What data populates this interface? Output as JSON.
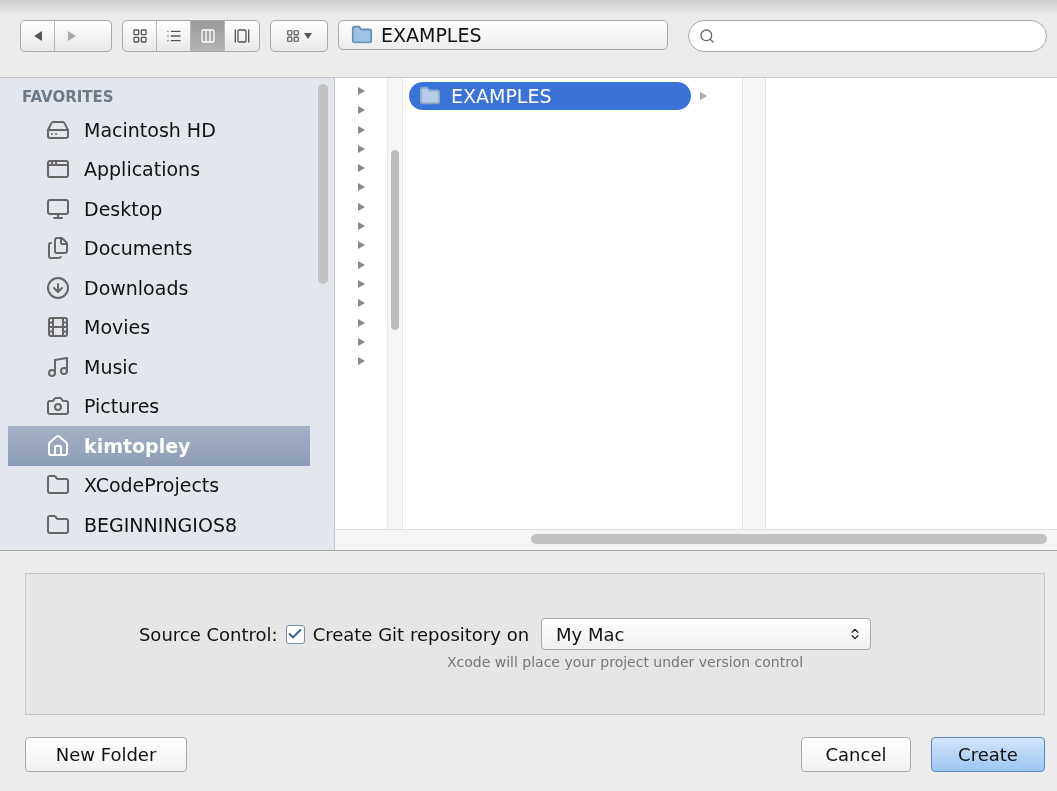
{
  "toolbar": {
    "view_modes": [
      {
        "kind": "icons",
        "selected": false
      },
      {
        "kind": "list",
        "selected": false
      },
      {
        "kind": "columns",
        "selected": true
      },
      {
        "kind": "coverflow",
        "selected": false
      }
    ],
    "path": "EXAMPLES"
  },
  "sidebar": {
    "heading": "FAVORITES",
    "items": [
      {
        "label": "Macintosh HD",
        "selected": false
      },
      {
        "label": "Applications",
        "selected": false
      },
      {
        "label": "Desktop",
        "selected": false
      },
      {
        "label": "Documents",
        "selected": false
      },
      {
        "label": "Downloads",
        "selected": false
      },
      {
        "label": "Movies",
        "selected": false
      },
      {
        "label": "Music",
        "selected": false
      },
      {
        "label": "Pictures",
        "selected": false
      },
      {
        "label": "kimtopley",
        "selected": true
      },
      {
        "label": "XCodeProjects",
        "selected": false
      },
      {
        "label": "BEGINNINGIOS8",
        "selected": false
      }
    ]
  },
  "browser": {
    "column_2": [
      {
        "label": "EXAMPLES",
        "selected": true
      }
    ]
  },
  "source_control": {
    "label": "Source Control:",
    "checkbox_label": "Create Git repository on",
    "checked": true,
    "location": "My Mac",
    "hint": "Xcode will place your project under version control"
  },
  "buttons": [
    {
      "label": "New Folder",
      "kind": "plain"
    },
    {
      "label": "Cancel",
      "kind": "plain"
    },
    {
      "label": "Create",
      "kind": "default"
    }
  ]
}
